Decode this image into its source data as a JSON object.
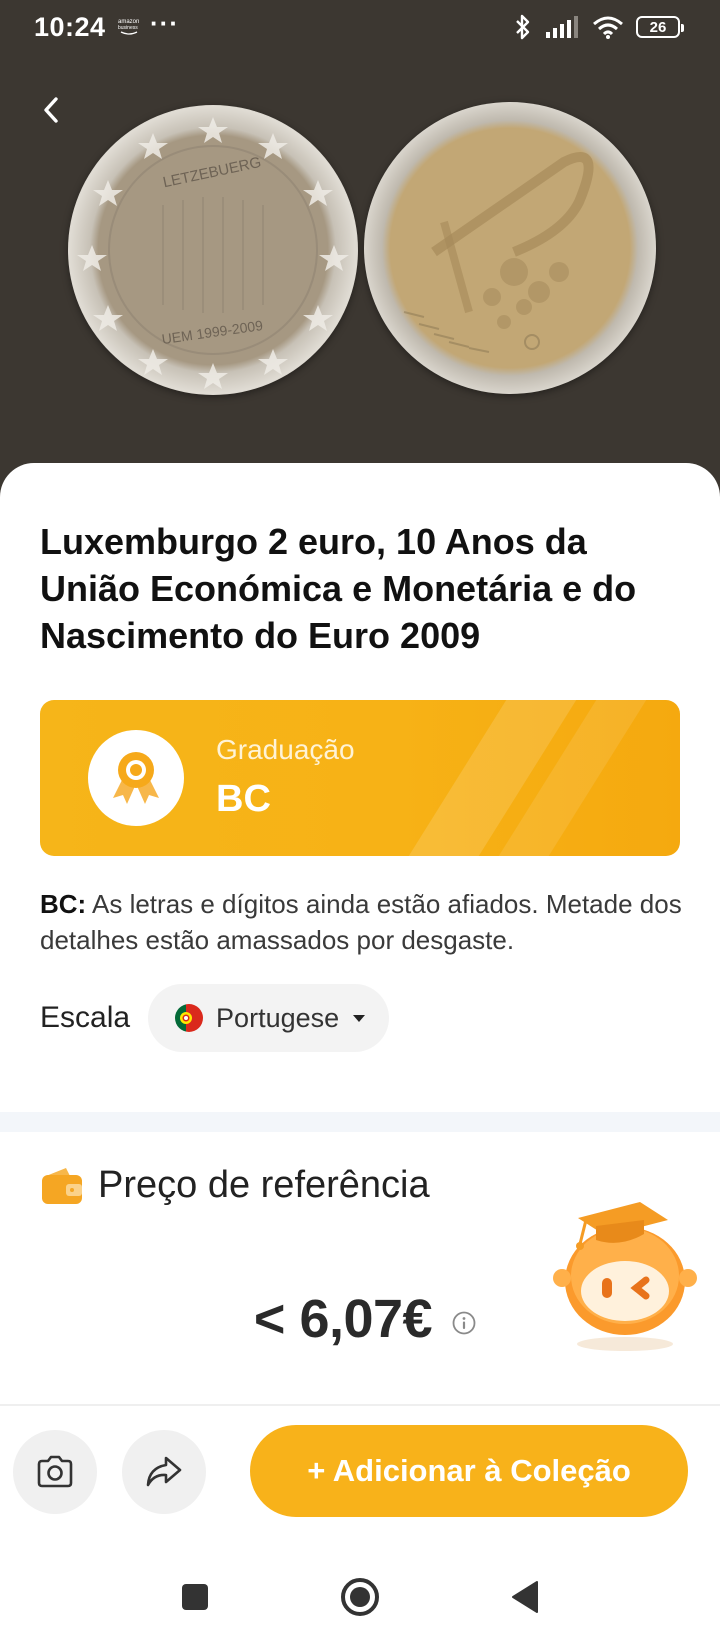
{
  "status_bar": {
    "time": "10:24",
    "dots": "···",
    "battery": "26",
    "icons": [
      "amazon-business-icon",
      "bluetooth-icon",
      "signal-icon",
      "wifi-icon",
      "battery-icon"
    ]
  },
  "hero": {
    "back_icon": "chevron-left-icon",
    "coin_left_text_top": "LETZEBUERG",
    "coin_left_text_bottom": "UEM 1999-2009",
    "background_color": "#3c3731"
  },
  "coin": {
    "title": "Luxemburgo 2 euro, 10 Anos da União Económica e Monetária e do Nascimento do Euro 2009"
  },
  "grade": {
    "label": "Graduação",
    "value": "BC",
    "icon": "award-medal-icon",
    "accent_color": "#f6b519"
  },
  "grade_description": {
    "code": "BC:",
    "text": " As letras e dígitos ainda estão afiados. Metade dos detalhes estão amassados por desgaste."
  },
  "scale": {
    "label": "Escala",
    "selected": "Portugese",
    "flag_icon": "portugal-flag-icon"
  },
  "price": {
    "heading": "Preço de referência",
    "value": "< 6,07€",
    "icon": "wallet-icon"
  },
  "actions": {
    "camera_icon": "camera-icon",
    "share_icon": "share-icon",
    "add_label": "+ Adicionar à Coleção"
  },
  "nav": {
    "icons": [
      "recents-square-icon",
      "home-circle-icon",
      "back-triangle-icon"
    ]
  }
}
